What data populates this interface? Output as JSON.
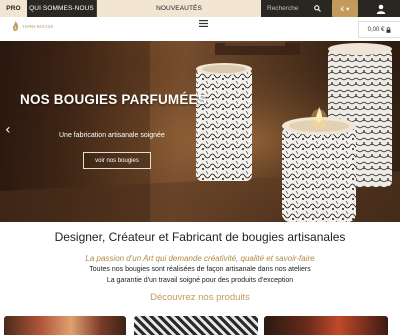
{
  "nav": {
    "pro": "PRO",
    "about": "QUI SOMMES-NOUS",
    "new": "NOUVEAUTÉS",
    "search_placeholder": "Recherche",
    "currency": "€ ▾"
  },
  "header": {
    "logo_text": "TAPHA BOUGIE",
    "cart": "0,00 €"
  },
  "hero": {
    "title": "NOS BOUGIES PARFUMÉES",
    "subtitle": "Une fabrication artisanale soignée",
    "button": "voir nos bougies"
  },
  "intro": {
    "title": "Designer, Créateur et Fabricant de bougies artisanales",
    "tagline": "La passion d'un Art qui demande créativité, qualité et savoir-faire",
    "line1": "Toutes nos bougies sont réalisées de façon artisanale dans nos ateliers",
    "line2": "La garantie d'un travail soigné pour des produits d'exception"
  },
  "products": {
    "heading": "Découvrez nos produits"
  },
  "colors": {
    "accent": "#c29b5a",
    "dark": "#2a2622",
    "cream": "#f2e6d3"
  }
}
